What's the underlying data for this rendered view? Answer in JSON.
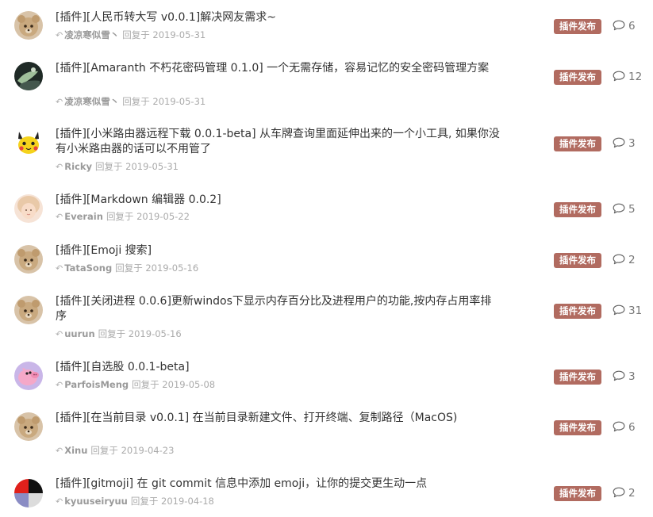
{
  "topics": [
    {
      "title": "[插件][人民币转大写 v0.0.1]解决网友需求~",
      "user": "凌凉寒似雪丶",
      "replied_label": "回复于",
      "date": "2019-05-31",
      "badge": "插件发布",
      "replies": "6",
      "avatar": "bear"
    },
    {
      "title": "[插件][Amaranth 不朽花密码管理 0.1.0] 一个无需存储，容易记忆的安全密码管理方案",
      "user": "凌凉寒似雪丶",
      "replied_label": "回复于",
      "date": "2019-05-31",
      "badge": "插件发布",
      "replies": "12",
      "avatar": "dark"
    },
    {
      "title": "[插件][小米路由器远程下载 0.0.1-beta] 从车牌查询里面延伸出来的一个小工具, 如果你没有小米路由器的话可以不用管了",
      "user": "Ricky",
      "replied_label": "回复于",
      "date": "2019-05-31",
      "badge": "插件发布",
      "replies": "3",
      "avatar": "pikachu"
    },
    {
      "title": "[插件][Markdown 编辑器 0.0.2]",
      "user": "Everain",
      "replied_label": "回复于",
      "date": "2019-05-22",
      "badge": "插件发布",
      "replies": "5",
      "avatar": "girl"
    },
    {
      "title": "[插件][Emoji 搜索]",
      "user": "TataSong",
      "replied_label": "回复于",
      "date": "2019-05-16",
      "badge": "插件发布",
      "replies": "2",
      "avatar": "bear"
    },
    {
      "title": "[插件][关闭进程 0.0.6]更新windos下显示内存百分比及进程用户的功能,按内存占用率排序",
      "user": "uurun",
      "replied_label": "回复于",
      "date": "2019-05-16",
      "badge": "插件发布",
      "replies": "31",
      "avatar": "bear"
    },
    {
      "title": "[插件][自选股 0.0.1-beta]",
      "user": "ParfoisMeng",
      "replied_label": "回复于",
      "date": "2019-05-08",
      "badge": "插件发布",
      "replies": "3",
      "avatar": "pig"
    },
    {
      "title": "[插件][在当前目录 v0.0.1] 在当前目录新建文件、打开终端、复制路径（MacOS)",
      "user": "Xinu",
      "replied_label": "回复于",
      "date": "2019-04-23",
      "badge": "插件发布",
      "replies": "6",
      "avatar": "bear"
    },
    {
      "title": "[插件][gitmoji] 在 git commit 信息中添加 emoji，让你的提交更生动一点",
      "user": "kyuuseiryuu",
      "replied_label": "回复于",
      "date": "2019-04-18",
      "badge": "插件发布",
      "replies": "2",
      "avatar": "quad"
    }
  ],
  "colors": {
    "badge": "#b16b60",
    "meta": "#aaaaaa",
    "title": "#333333"
  },
  "icons": {
    "reply": "reply-arrow-icon",
    "comment": "comment-bubble-icon"
  }
}
